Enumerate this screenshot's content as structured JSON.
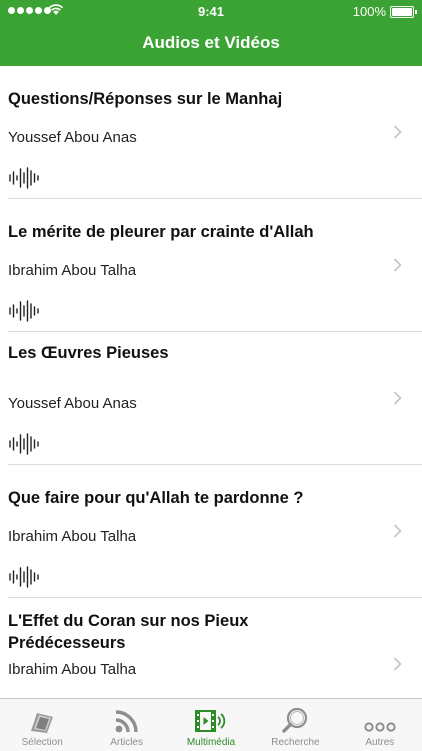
{
  "status": {
    "time": "9:41",
    "battery": "100%"
  },
  "header": {
    "title": "Audios et Vidéos"
  },
  "items": [
    {
      "title": "Questions/Réponses sur le Manhaj",
      "author": "Youssef Abou Anas"
    },
    {
      "title": "Le mérite de pleurer par crainte d'Allah",
      "author": "Ibrahim Abou Talha"
    },
    {
      "title": "Les Œuvres Pieuses",
      "author": "Youssef Abou Anas"
    },
    {
      "title": "Que faire pour qu'Allah te pardonne ?",
      "author": "Ibrahim Abou Talha"
    },
    {
      "title": "L'Effet du Coran sur nos Pieux Prédécesseurs",
      "author": "Ibrahim Abou Talha"
    }
  ],
  "tabs": [
    {
      "label": "Sélection",
      "icon": "selection-icon"
    },
    {
      "label": "Articles",
      "icon": "rss-icon"
    },
    {
      "label": "Multimédia",
      "icon": "multimedia-icon",
      "active": true
    },
    {
      "label": "Recherche",
      "icon": "search-icon"
    },
    {
      "label": "Autres",
      "icon": "more-icon"
    }
  ],
  "colors": {
    "accent": "#3aa334",
    "active_tab": "#2e8b28",
    "inactive_tab": "#8e8e8e"
  }
}
